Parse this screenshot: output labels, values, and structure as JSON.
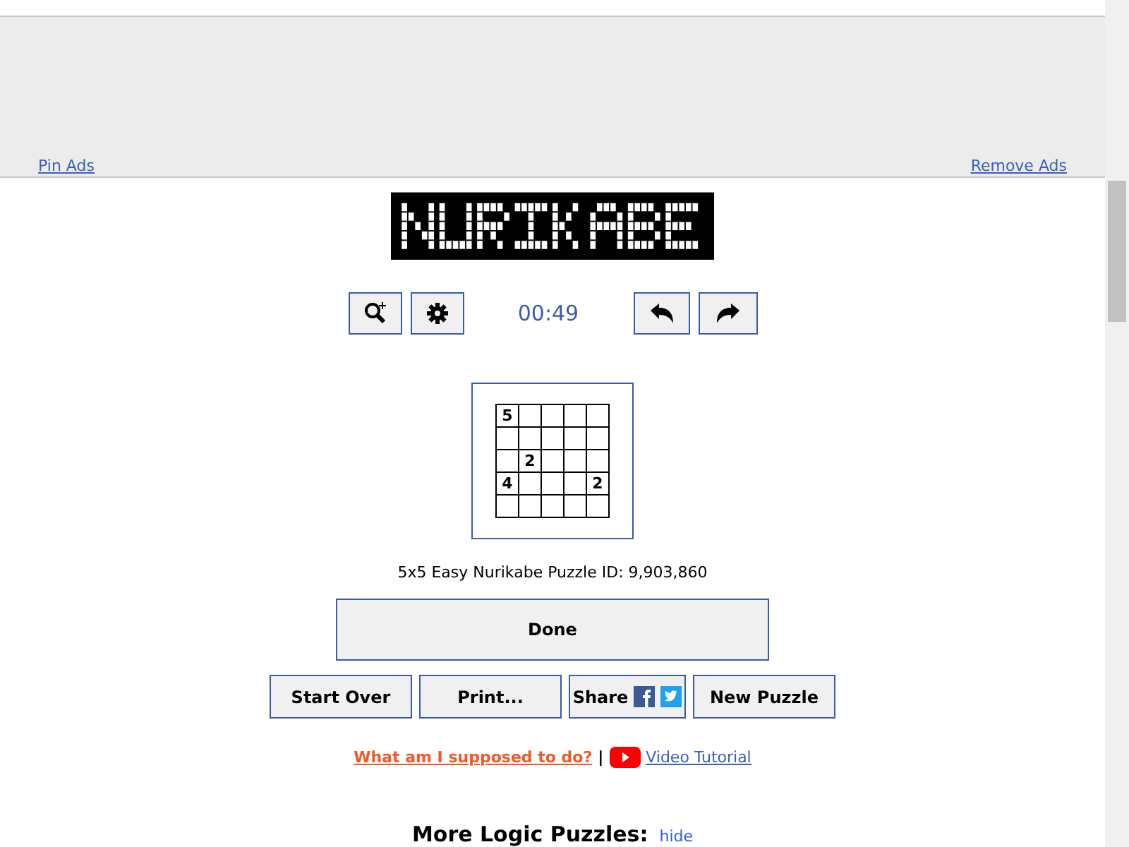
{
  "ad_bar": {
    "pin_link": "Pin Ads",
    "remove_link": "Remove Ads"
  },
  "toolbar": {
    "timer": "00:49"
  },
  "grid": {
    "rows": [
      [
        {
          "clue": "5",
          "shaded": false
        },
        {
          "shaded": false
        },
        {
          "shaded": false
        },
        {
          "shaded": false
        },
        {
          "shaded": false
        }
      ],
      [
        {
          "shaded": false
        },
        {
          "shaded": false
        },
        {
          "shaded": false
        },
        {
          "shaded": false
        },
        {
          "shaded": false
        }
      ],
      [
        {
          "shaded": false
        },
        {
          "clue": "2",
          "shaded": false
        },
        {
          "shaded": false
        },
        {
          "shaded": false
        },
        {
          "shaded": false
        }
      ],
      [
        {
          "clue": "4",
          "shaded": false
        },
        {
          "shaded": false
        },
        {
          "shaded": false
        },
        {
          "shaded": false
        },
        {
          "clue": "2",
          "shaded": false
        }
      ],
      [
        {
          "shaded": false
        },
        {
          "shaded": false
        },
        {
          "shaded": false
        },
        {
          "shaded": false
        },
        {
          "shaded": false
        }
      ]
    ]
  },
  "puzzle_info": "5x5 Easy Nurikabe Puzzle ID: 9,903,860",
  "done_button": "Done",
  "buttons": [
    {
      "kind": "plain",
      "label": "Start Over"
    },
    {
      "kind": "plain",
      "label": "Print..."
    },
    {
      "kind": "share",
      "label": "Share"
    },
    {
      "kind": "plain",
      "label": "New Puzzle"
    }
  ],
  "help": {
    "question_link": "What am I supposed to do?",
    "separator": "|",
    "video_link": "Video Tutorial"
  },
  "more": {
    "heading": "More Logic Puzzles:",
    "hide_link": "hide"
  }
}
